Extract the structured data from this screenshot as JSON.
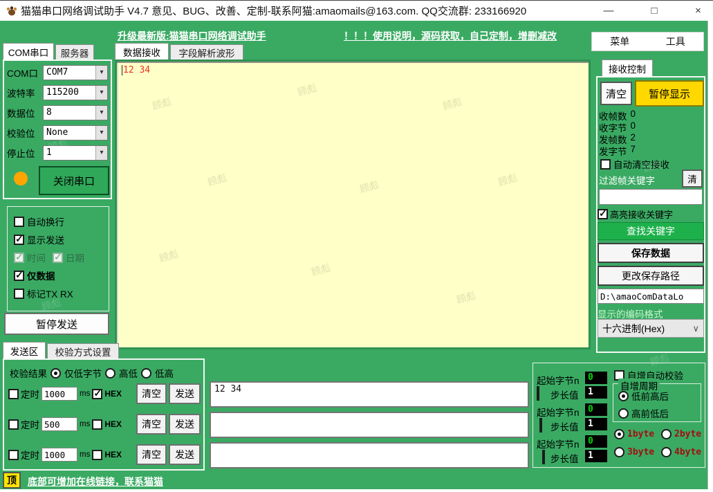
{
  "window": {
    "title": "猫猫串口网络调试助手 V4.7 意见、BUG、改善、定制-联系阿猫:amaomails@163.com. QQ交流群: 233166920"
  },
  "icons": {
    "app_icon": "paw",
    "minimize": "—",
    "maximize": "□",
    "close": "×",
    "dropdown_arrow": "▾",
    "select_arrow": "∨"
  },
  "colors": {
    "app_green": "#3aaa63",
    "receive_bg": "#ffffc8",
    "pause_gold": "#ffd800",
    "find_green": "#1db04b",
    "led_orange": "#ffa500",
    "rx_text_red": "#f03022",
    "byte_label_red": "#a01010"
  },
  "watermark": "顾彪",
  "header": {
    "upgrade_link": "升级最新版:猫猫串口网络调试助手",
    "help_link": "！！！使用说明，源码获取，自己定制，增删减改",
    "menu": [
      {
        "label": "菜单"
      },
      {
        "label": "工具"
      }
    ]
  },
  "serial": {
    "tabs": [
      {
        "label": "COM串口"
      },
      {
        "label": "服务器"
      }
    ],
    "fields": [
      {
        "label": "COM口",
        "value": "COM7"
      },
      {
        "label": "波特率",
        "value": "115200"
      },
      {
        "label": "数据位",
        "value": "8"
      },
      {
        "label": "校验位",
        "value": "None"
      },
      {
        "label": "停止位",
        "value": "1"
      }
    ],
    "close_button": "关闭串口",
    "options": [
      {
        "label": "自动换行",
        "checked": false
      },
      {
        "label": "显示发送",
        "checked": true
      },
      {
        "label": "时间",
        "checked": true,
        "disabled": true
      },
      {
        "label": "日期",
        "checked": true,
        "disabled": true
      },
      {
        "label": "仅数据",
        "checked": true
      },
      {
        "label": "标记TX RX",
        "checked": false
      }
    ],
    "pause_send_button": "暂停发送"
  },
  "receive": {
    "tabs": [
      {
        "label": "数据接收"
      },
      {
        "label": "字段解析波形"
      }
    ],
    "content": "12 34"
  },
  "receive_control": {
    "tab": "接收控制",
    "clear_button": "清空",
    "pause_display_button": "暂停显示",
    "stats": [
      {
        "label": "收帧数",
        "value": "0"
      },
      {
        "label": "收字节",
        "value": "0"
      },
      {
        "label": "发帧数",
        "value": "2"
      },
      {
        "label": "发字节",
        "value": "7"
      }
    ],
    "auto_clear": {
      "label": "自动清空接收",
      "checked": false
    },
    "filter_label": "过滤帧关键字",
    "filter_clear_button": "清",
    "filter_value": "",
    "highlight": {
      "label": "高亮接收关键字",
      "checked": true
    },
    "find_keyword_button": "查找关键字",
    "save_data_button": "保存数据",
    "change_path_button": "更改保存路径",
    "save_path": "D:\\amaoComDataLo",
    "encoding_label": "显示的编码格式",
    "encoding_value": "十六进制(Hex)"
  },
  "send": {
    "tabs": [
      {
        "label": "发送区"
      },
      {
        "label": "校验方式设置"
      }
    ],
    "checksum": {
      "label": "校验结果",
      "options": [
        {
          "label": "仅低字节",
          "selected": true
        },
        {
          "label": "高低",
          "selected": false
        },
        {
          "label": "低高",
          "selected": false
        }
      ]
    },
    "rows": [
      {
        "timer_label": "定时",
        "timer_checked": false,
        "interval": "1000",
        "unit": "ms",
        "hex_label": "HEX",
        "hex_checked": true,
        "clear_label": "清空",
        "send_label": "发送",
        "message": "12 34"
      },
      {
        "timer_label": "定时",
        "timer_checked": false,
        "interval": "500",
        "unit": "ms",
        "hex_label": "HEX",
        "hex_checked": false,
        "clear_label": "清空",
        "send_label": "发送",
        "message": ""
      },
      {
        "timer_label": "定时",
        "timer_checked": false,
        "interval": "1000",
        "unit": "ms",
        "hex_label": "HEX",
        "hex_checked": false,
        "clear_label": "清空",
        "send_label": "发送",
        "message": ""
      }
    ]
  },
  "auto_increment": {
    "groups": [
      {
        "start_label": "起始字节n",
        "start_value": "0",
        "step_label": "步长值",
        "step_value": "1",
        "step_checked": false
      },
      {
        "start_label": "起始字节n",
        "start_value": "0",
        "step_label": "步长值",
        "step_value": "1",
        "step_checked": false
      },
      {
        "start_label": "起始字节n",
        "start_value": "0",
        "step_label": "步长值",
        "step_value": "1",
        "step_checked": false
      }
    ],
    "auto_check": {
      "label": "自增自动校验",
      "checked": false
    },
    "cycle": {
      "label": "自增周期",
      "options": [
        {
          "label": "低前高后",
          "selected": true
        },
        {
          "label": "高前低后",
          "selected": false
        }
      ]
    },
    "byte_options": [
      {
        "label": "1byte",
        "selected": true
      },
      {
        "label": "2byte",
        "selected": false
      },
      {
        "label": "3byte",
        "selected": false
      },
      {
        "label": "4byte",
        "selected": false
      }
    ]
  },
  "footer": {
    "top_button": "顶",
    "link": "底部可增加在线链接，联系猫猫"
  }
}
